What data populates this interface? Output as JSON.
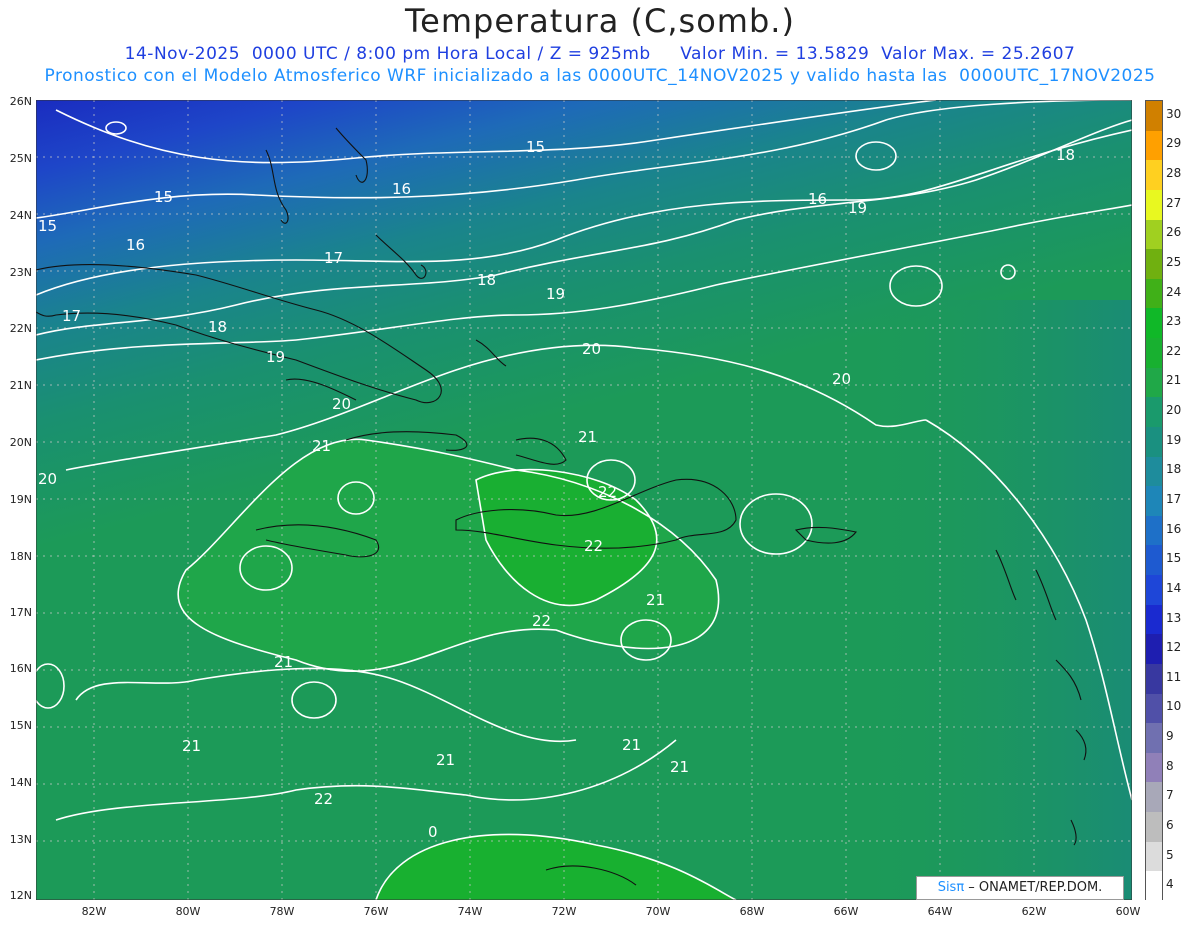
{
  "header": {
    "title": "Temperatura (C,somb.)",
    "line1": "14-Nov-2025  0000 UTC / 8:00 pm Hora Local / Z = 925mb     Valor Min. = 13.5829  Valor Max. = 25.2607",
    "line2": "Pronostico con el Modelo Atmosferico WRF inicializado a las 0000UTC_14NOV2025 y valido hasta las  0000UTC_17NOV2025"
  },
  "axes": {
    "lat_labels": [
      "26N",
      "25N",
      "24N",
      "23N",
      "22N",
      "21N",
      "20N",
      "19N",
      "18N",
      "17N",
      "16N",
      "15N",
      "14N",
      "13N",
      "12N"
    ],
    "lon_labels": [
      "82W",
      "80W",
      "78W",
      "76W",
      "74W",
      "72W",
      "70W",
      "68W",
      "66W",
      "64W",
      "62W",
      "60W"
    ]
  },
  "colorbar": {
    "values": [
      "4",
      "5",
      "6",
      "7",
      "8",
      "9",
      "10",
      "11",
      "12",
      "13",
      "14",
      "15",
      "16",
      "17",
      "18",
      "19",
      "20",
      "21",
      "22",
      "23",
      "24",
      "25",
      "26",
      "27",
      "28",
      "29",
      "30"
    ],
    "colors": [
      "#ffffff",
      "#dcdcdc",
      "#bdbdbd",
      "#a8a8b8",
      "#9080b8",
      "#7070b0",
      "#5050a8",
      "#3838a0",
      "#1e1eb0",
      "#1a2ad0",
      "#1e46d8",
      "#1e5ad0",
      "#1e70c8",
      "#1e86b8",
      "#1e8c9c",
      "#1a9080",
      "#1a9a6c",
      "#20a848",
      "#18b030",
      "#10b828",
      "#40b018",
      "#70b010",
      "#a0d020",
      "#e8f820",
      "#ffd020",
      "#ffa000",
      "#d08000"
    ]
  },
  "contour_labels": [
    "15",
    "15",
    "15",
    "16",
    "16",
    "16",
    "17",
    "17",
    "18",
    "18",
    "18",
    "19",
    "19",
    "19",
    "20",
    "20",
    "20",
    "20",
    "21",
    "21",
    "21",
    "21",
    "21",
    "21",
    "21",
    "21",
    "22",
    "22",
    "22",
    "22",
    "0"
  ],
  "branding": {
    "sis": "Sisπ",
    "rest": " – ONAMET/REP.DOM."
  }
}
